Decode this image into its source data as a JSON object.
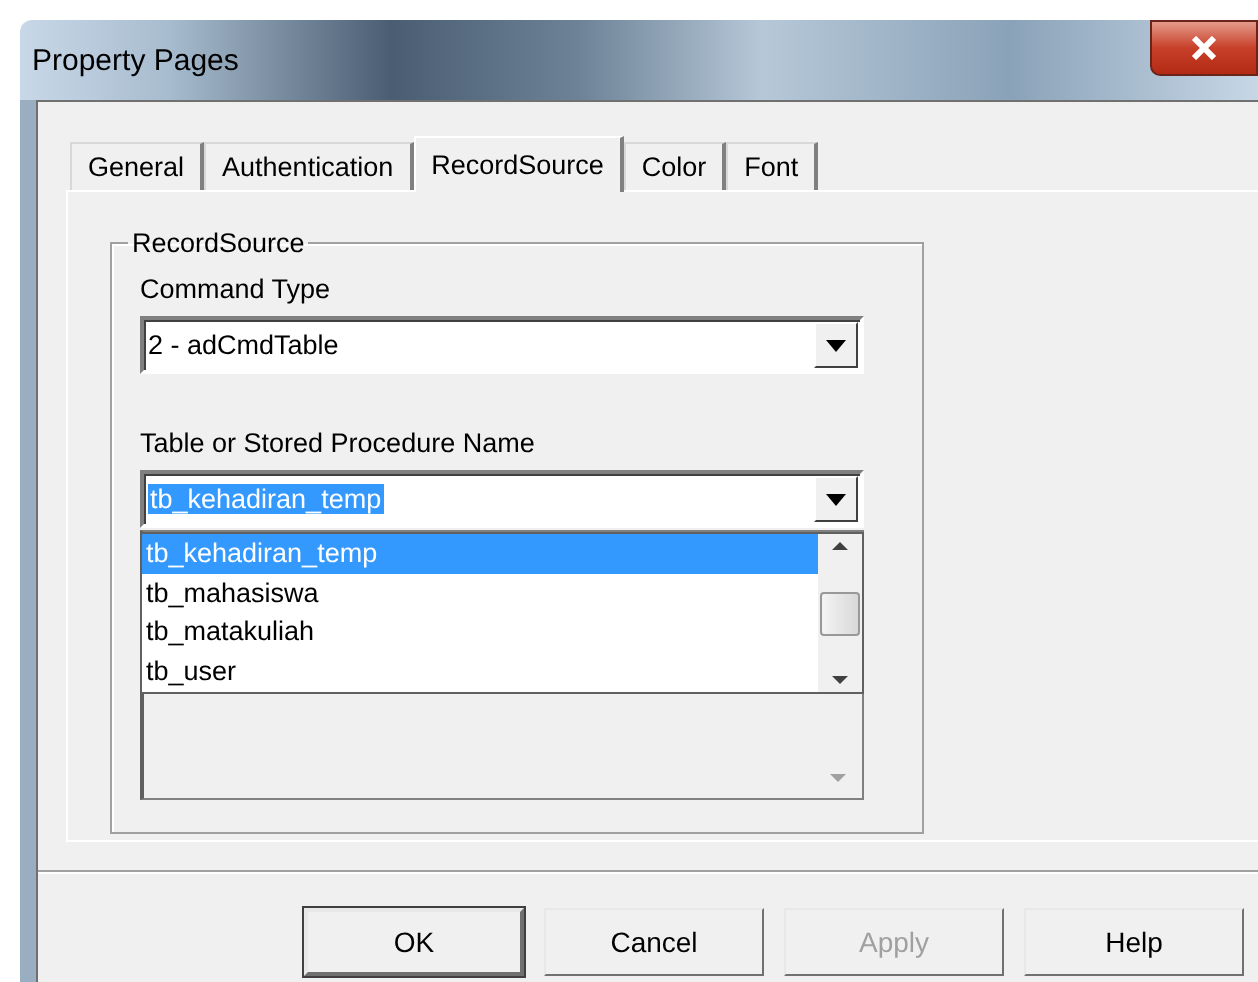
{
  "window": {
    "title": "Property Pages"
  },
  "tabs": [
    {
      "label": "General",
      "selected": false
    },
    {
      "label": "Authentication",
      "selected": false
    },
    {
      "label": "RecordSource",
      "selected": true
    },
    {
      "label": "Color",
      "selected": false
    },
    {
      "label": "Font",
      "selected": false
    }
  ],
  "group": {
    "title": "RecordSource",
    "command_type": {
      "label": "Command Type",
      "value": "2 - adCmdTable"
    },
    "table_name": {
      "label": "Table or Stored Procedure Name",
      "value": "tb_kehadiran_temp",
      "text_selected": true,
      "items": [
        {
          "label": "tb_kehadiran_temp",
          "selected": true
        },
        {
          "label": "tb_mahasiswa",
          "selected": false
        },
        {
          "label": "tb_matakuliah",
          "selected": false
        },
        {
          "label": "tb_user",
          "selected": false
        }
      ]
    }
  },
  "buttons": [
    {
      "label": "OK",
      "default": true,
      "disabled": false
    },
    {
      "label": "Cancel",
      "default": false,
      "disabled": false
    },
    {
      "label": "Apply",
      "default": false,
      "disabled": true
    },
    {
      "label": "Help",
      "default": false,
      "disabled": false
    }
  ]
}
